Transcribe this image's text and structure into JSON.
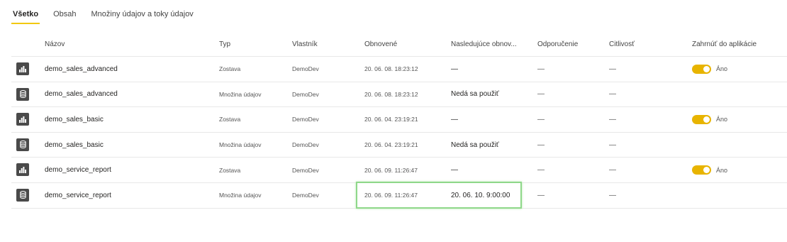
{
  "tabs": [
    {
      "label": "Všetko",
      "active": true
    },
    {
      "label": "Obsah",
      "active": false
    },
    {
      "label": "Množiny údajov a toky údajov",
      "active": false
    }
  ],
  "columns": {
    "name": "Názov",
    "type": "Typ",
    "owner": "Vlastník",
    "refreshed": "Obnovené",
    "next_refresh": "Nasledujúce obnov...",
    "endorsement": "Odporučenie",
    "sensitivity": "Citlivosť",
    "include_in_app": "Zahrnúť do aplikácie"
  },
  "rows": [
    {
      "icon": "report-icon",
      "name": "demo_sales_advanced",
      "type": "Zostava",
      "owner": "DemoDev",
      "refreshed": "20. 06. 08. 18:23:12",
      "next_refresh": "—",
      "endorsement": "—",
      "sensitivity": "—",
      "include_toggle": true,
      "include_label": "Áno"
    },
    {
      "icon": "dataset-icon",
      "name": "demo_sales_advanced",
      "type": "Množina údajov",
      "owner": "DemoDev",
      "refreshed": "20. 06. 08. 18:23:12",
      "next_refresh": "Nedá sa použiť",
      "endorsement": "—",
      "sensitivity": "—",
      "include_toggle": false,
      "include_label": ""
    },
    {
      "icon": "report-icon",
      "name": "demo_sales_basic",
      "type": "Zostava",
      "owner": "DemoDev",
      "refreshed": "20. 06. 04. 23:19:21",
      "next_refresh": "—",
      "endorsement": "—",
      "sensitivity": "—",
      "include_toggle": true,
      "include_label": "Áno"
    },
    {
      "icon": "dataset-icon",
      "name": "demo_sales_basic",
      "type": "Množina údajov",
      "owner": "DemoDev",
      "refreshed": "20. 06. 04. 23:19:21",
      "next_refresh": "Nedá sa použiť",
      "endorsement": "—",
      "sensitivity": "—",
      "include_toggle": false,
      "include_label": ""
    },
    {
      "icon": "report-icon",
      "name": "demo_service_report",
      "type": "Zostava",
      "owner": "DemoDev",
      "refreshed": "20. 06. 09. 11:26:47",
      "next_refresh": "—",
      "endorsement": "—",
      "sensitivity": "—",
      "include_toggle": true,
      "include_label": "Áno"
    },
    {
      "icon": "dataset-icon",
      "name": "demo_service_report",
      "type": "Množina údajov",
      "owner": "DemoDev",
      "refreshed": "20. 06. 09. 11:26:47",
      "next_refresh": "20. 06. 10. 9:00:00",
      "endorsement": "—",
      "sensitivity": "—",
      "include_toggle": false,
      "include_label": ""
    }
  ],
  "colors": {
    "accent": "#f2c811",
    "toggle_on": "#e8b400",
    "highlight": "#8fd88a",
    "icon_bg": "#4a4a4a"
  }
}
